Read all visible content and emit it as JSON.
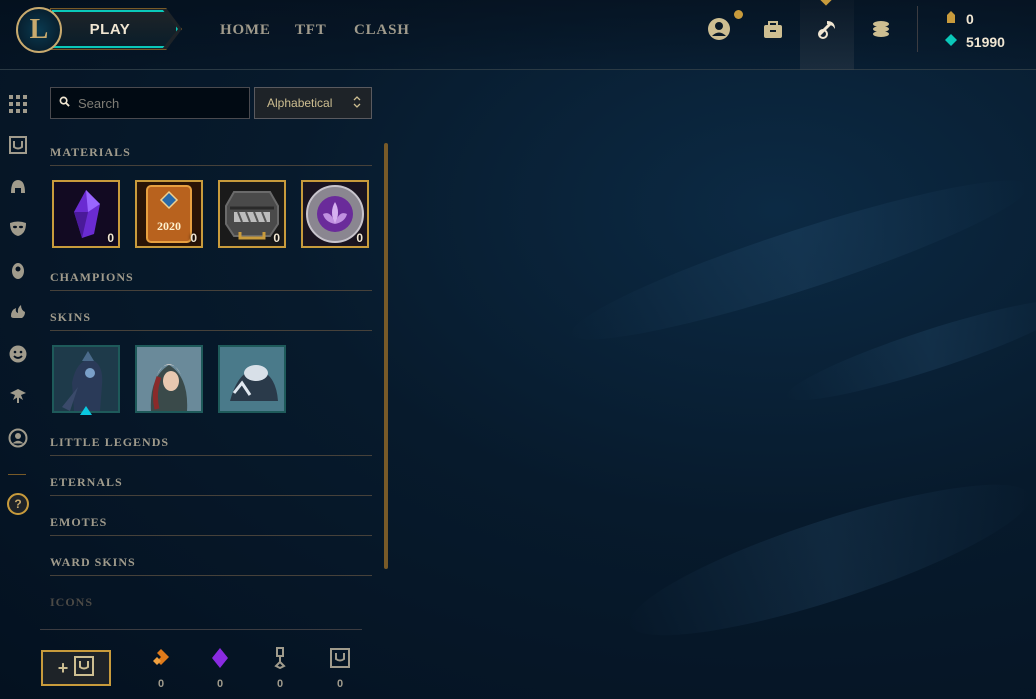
{
  "header": {
    "logo_letter": "L",
    "play_label": "PLAY",
    "nav": [
      "HOME",
      "TFT",
      "CLASH"
    ],
    "icons": [
      "profile-icon",
      "store-icon",
      "loot-icon",
      "currency-store-icon"
    ],
    "currencies": [
      {
        "name": "blue-essence-icon",
        "value": "0"
      },
      {
        "name": "rp-icon",
        "value": "51990"
      }
    ]
  },
  "rail": {
    "icons": [
      "overview-grid-icon",
      "chest-icon",
      "helmet-icon",
      "mask-icon",
      "ward-icon",
      "chroma-icon",
      "emote-icon",
      "little-legend-icon",
      "profile-circle-icon"
    ],
    "help_label": "?"
  },
  "search": {
    "placeholder": "Search",
    "value": ""
  },
  "sort": {
    "selected": "Alphabetical"
  },
  "sections": {
    "materials": "MATERIALS",
    "champions": "CHAMPIONS",
    "skins": "SKINS",
    "little_legends": "LITTLE LEGENDS",
    "eternals": "ETERNALS",
    "emotes": "EMOTES",
    "ward_skins": "WARD SKINS",
    "icons": "ICONS"
  },
  "materials": [
    {
      "name": "crystal-shard",
      "count": "0",
      "label": ""
    },
    {
      "name": "event-pass-2020",
      "count": "0",
      "label": "2020"
    },
    {
      "name": "hextech-chest",
      "count": "0",
      "label": ""
    },
    {
      "name": "orb-token",
      "count": "0",
      "label": ""
    }
  ],
  "skins": [
    "skin-1",
    "skin-2",
    "skin-3"
  ],
  "bottom": {
    "resources": [
      {
        "name": "orange-essence-icon",
        "value": "0"
      },
      {
        "name": "mythic-essence-icon",
        "value": "0"
      },
      {
        "name": "key-fragment-icon",
        "value": "0"
      },
      {
        "name": "chest-icon",
        "value": "0"
      }
    ]
  },
  "colors": {
    "gold": "#c89b3c",
    "teal": "#0ac8b9",
    "text": "#a09b8c",
    "purple": "#8a2be2"
  }
}
